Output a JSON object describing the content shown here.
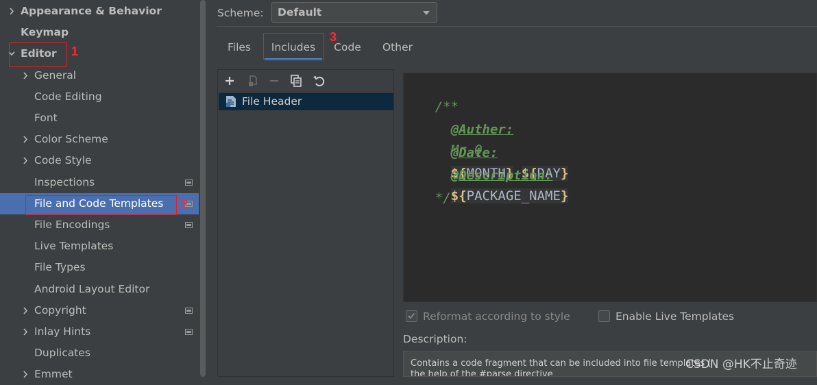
{
  "sidebar": {
    "items": [
      {
        "label": "Appearance & Behavior",
        "expanded": false,
        "has_chevron": true
      },
      {
        "label": "Keymap",
        "has_chevron": false
      },
      {
        "label": "Editor",
        "expanded": true,
        "has_chevron": true
      },
      {
        "label": "General",
        "has_chevron": true
      },
      {
        "label": "Code Editing",
        "has_chevron": false
      },
      {
        "label": "Font",
        "has_chevron": false
      },
      {
        "label": "Color Scheme",
        "has_chevron": true
      },
      {
        "label": "Code Style",
        "has_chevron": true
      },
      {
        "label": "Inspections",
        "has_chevron": false,
        "project_icon": true
      },
      {
        "label": "File and Code Templates",
        "has_chevron": false,
        "selected": true,
        "project_icon": true
      },
      {
        "label": "File Encodings",
        "has_chevron": false,
        "project_icon": true
      },
      {
        "label": "Live Templates",
        "has_chevron": false
      },
      {
        "label": "File Types",
        "has_chevron": false
      },
      {
        "label": "Android Layout Editor",
        "has_chevron": false
      },
      {
        "label": "Copyright",
        "has_chevron": true,
        "project_icon": true
      },
      {
        "label": "Inlay Hints",
        "has_chevron": true,
        "project_icon": true
      },
      {
        "label": "Duplicates",
        "has_chevron": false
      },
      {
        "label": "Emmet",
        "has_chevron": true
      }
    ]
  },
  "annotations": {
    "one": "1",
    "two": "2",
    "three": "3"
  },
  "scheme": {
    "label": "Scheme:",
    "value": "Default"
  },
  "tabs": [
    {
      "label": "Files"
    },
    {
      "label": "Includes",
      "active": true
    },
    {
      "label": "Code"
    },
    {
      "label": "Other"
    }
  ],
  "toolbar": {
    "icons": [
      "add-icon",
      "copy-icon",
      "remove-icon",
      "duplicate-icon",
      "reset-icon"
    ]
  },
  "templates": {
    "items": [
      {
        "label": "File Header",
        "selected": true
      }
    ]
  },
  "editor": {
    "open_comment": "/**",
    "auther_tag": "@Auther:",
    "auther_value": "Mr.Q",
    "date_tag": "@Date:",
    "var_open": "${",
    "var_close": "}",
    "month": "MONTH",
    "dash": "-",
    "day": "DAY",
    "description_tag": "@Description:",
    "package_name": "PACKAGE_NAME",
    "close_comment": "*/"
  },
  "options": {
    "reformat_label": "Reformat according to style",
    "reformat_checked": true,
    "live_templates_label": "Enable Live Templates",
    "live_templates_checked": false
  },
  "description": {
    "label": "Description:",
    "line1": "Contains a code fragment that can be included into file templates (",
    "line2": "the help of the #parse directive"
  },
  "watermark": "CSDN @HK不止奇迹",
  "colors": {
    "selection": "#4b6eaf",
    "annotation": "#e02020",
    "tab_underline": "#4a88c7"
  }
}
